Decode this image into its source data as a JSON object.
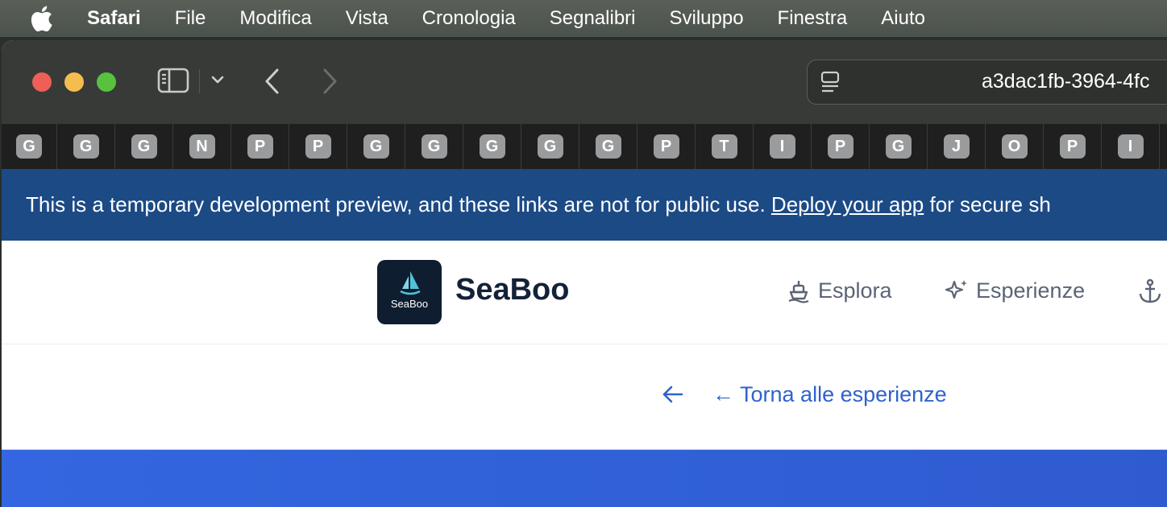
{
  "menubar": {
    "app_name": "Safari",
    "items": [
      "File",
      "Modifica",
      "Vista",
      "Cronologia",
      "Segnalibri",
      "Sviluppo",
      "Finestra",
      "Aiuto"
    ]
  },
  "toolbar": {
    "address": "a3dac1fb-3964-4fc"
  },
  "favorites": [
    "G",
    "G",
    "G",
    "N",
    "P",
    "P",
    "G",
    "G",
    "G",
    "G",
    "G",
    "P",
    "T",
    "I",
    "P",
    "G",
    "J",
    "O",
    "P",
    "I"
  ],
  "banner": {
    "text": "This is a temporary development preview, and these links are not for public use. ",
    "link": "Deploy your app",
    "text_after": " for secure sh"
  },
  "site": {
    "logo_text": "SeaBoo",
    "brand": "SeaBoo",
    "nav": {
      "explore": "Esplora",
      "experiences": "Esperienze"
    }
  },
  "back": {
    "label": "← Torna alle esperienze"
  },
  "colors": {
    "banner": "#1c4a85",
    "link": "#2f62cc",
    "hero": "#3366e0"
  }
}
